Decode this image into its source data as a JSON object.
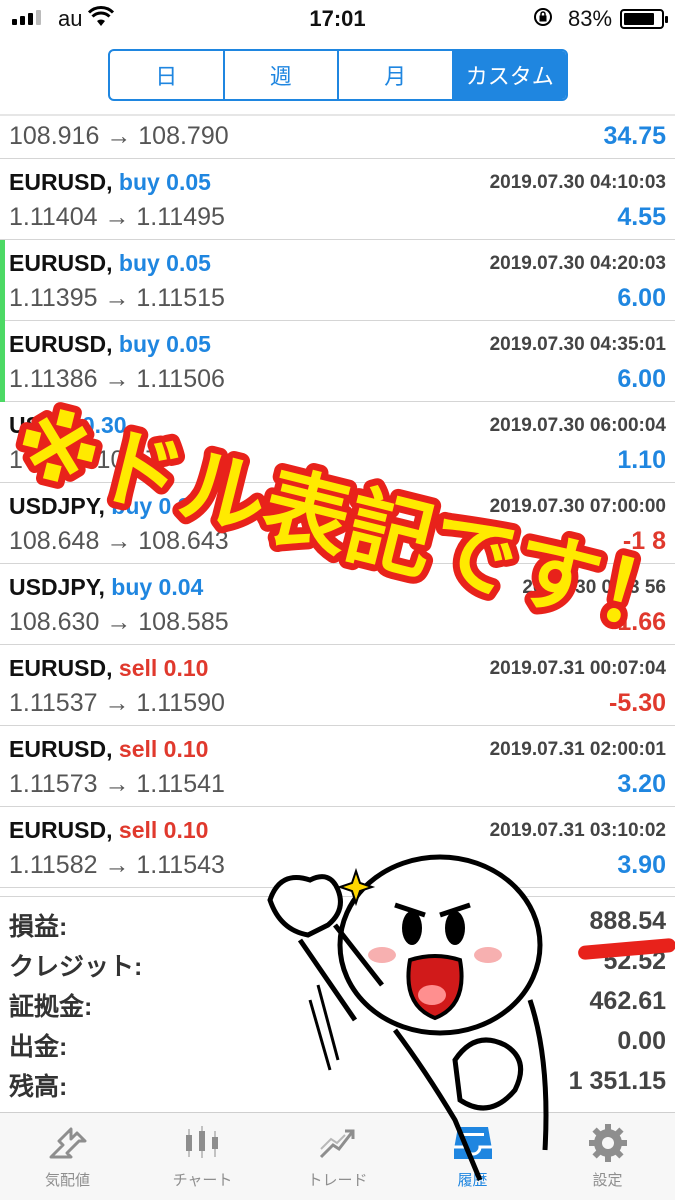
{
  "status_bar": {
    "carrier": "au",
    "time": "17:01",
    "battery": "83%",
    "battery_level": 0.83
  },
  "period_tabs": [
    {
      "label": "日",
      "active": false
    },
    {
      "label": "週",
      "active": false
    },
    {
      "label": "月",
      "active": false
    },
    {
      "label": "カスタム",
      "active": true
    }
  ],
  "trades": [
    {
      "pair": "",
      "side_label": "",
      "side": "sell",
      "date": "",
      "prices": "108.916 → 108.790",
      "pnl": "34.75",
      "pnl_sign": "pos",
      "marker": false
    },
    {
      "pair": "EURUSD,",
      "side_label": "buy 0.05",
      "side": "buy",
      "date": "2019.07.30 04:10:03",
      "prices": "1.11404 → 1.11495",
      "pnl": "4.55",
      "pnl_sign": "pos",
      "marker": false
    },
    {
      "pair": "EURUSD,",
      "side_label": "buy 0.05",
      "side": "buy",
      "date": "2019.07.30 04:20:03",
      "prices": "1.11395 → 1.11515",
      "pnl": "6.00",
      "pnl_sign": "pos",
      "marker": true
    },
    {
      "pair": "EURUSD,",
      "side_label": "buy 0.05",
      "side": "buy",
      "date": "2019.07.30 04:35:01",
      "prices": "1.11386 → 1.11506",
      "pnl": "6.00",
      "pnl_sign": "pos",
      "marker": true
    },
    {
      "pair": "US",
      "side_label": "bu 0.30",
      "side": "buy",
      "date": "2019.07.30 06:00:04",
      "prices": "1 33 → 108 7",
      "pnl": "1.10",
      "pnl_sign": "pos",
      "marker": false
    },
    {
      "pair": "USDJPY,",
      "side_label": "buy 0.30",
      "side": "buy",
      "date": "2019.07.30 07:00:00",
      "prices": "108.648 → 108.643",
      "pnl": "-1 8",
      "pnl_sign": "neg",
      "marker": false
    },
    {
      "pair": "USDJPY,",
      "side_label": "buy 0.04",
      "side": "buy",
      "date": "2019 .30 07:3 56",
      "prices": "108.630 → 108.585",
      "pnl": "-1.66",
      "pnl_sign": "neg",
      "marker": false
    },
    {
      "pair": "EURUSD,",
      "side_label": "sell 0.10",
      "side": "sell",
      "date": "2019.07.31 00:07:04",
      "prices": "1.11537 → 1.11590",
      "pnl": "-5.30",
      "pnl_sign": "neg",
      "marker": false
    },
    {
      "pair": "EURUSD,",
      "side_label": "sell 0.10",
      "side": "sell",
      "date": "2019.07.31 02:00:01",
      "prices": "1.11573 → 1.11541",
      "pnl": "3.20",
      "pnl_sign": "pos",
      "marker": false
    },
    {
      "pair": "EURUSD,",
      "side_label": "sell 0.10",
      "side": "sell",
      "date": "2019.07.31 03:10:02",
      "prices": "1.11582 → 1.11543",
      "pnl": "3.90",
      "pnl_sign": "pos",
      "marker": false
    }
  ],
  "summary": [
    {
      "label": "損益:",
      "value": "888.54"
    },
    {
      "label": "クレジット:",
      "value": "52.52"
    },
    {
      "label": "証拠金:",
      "value": "462.61"
    },
    {
      "label": "出金:",
      "value": "0.00"
    },
    {
      "label": "残高:",
      "value": "1 351.15"
    }
  ],
  "tabbar": [
    {
      "label": "気配値",
      "icon": "quotes-icon",
      "active": false
    },
    {
      "label": "チャート",
      "icon": "chart-icon",
      "active": false
    },
    {
      "label": "トレード",
      "icon": "trade-icon",
      "active": false
    },
    {
      "label": "履歴",
      "icon": "history-icon",
      "active": true
    },
    {
      "label": "設定",
      "icon": "settings-icon",
      "active": false
    }
  ],
  "overlay": {
    "caption": "※ドル表記です！"
  },
  "colors": {
    "accent": "#1f86e0",
    "sell": "#e0392d",
    "marker": "#4cd964",
    "caption_fill": "#ffea00",
    "caption_stroke": "#e8221b"
  }
}
